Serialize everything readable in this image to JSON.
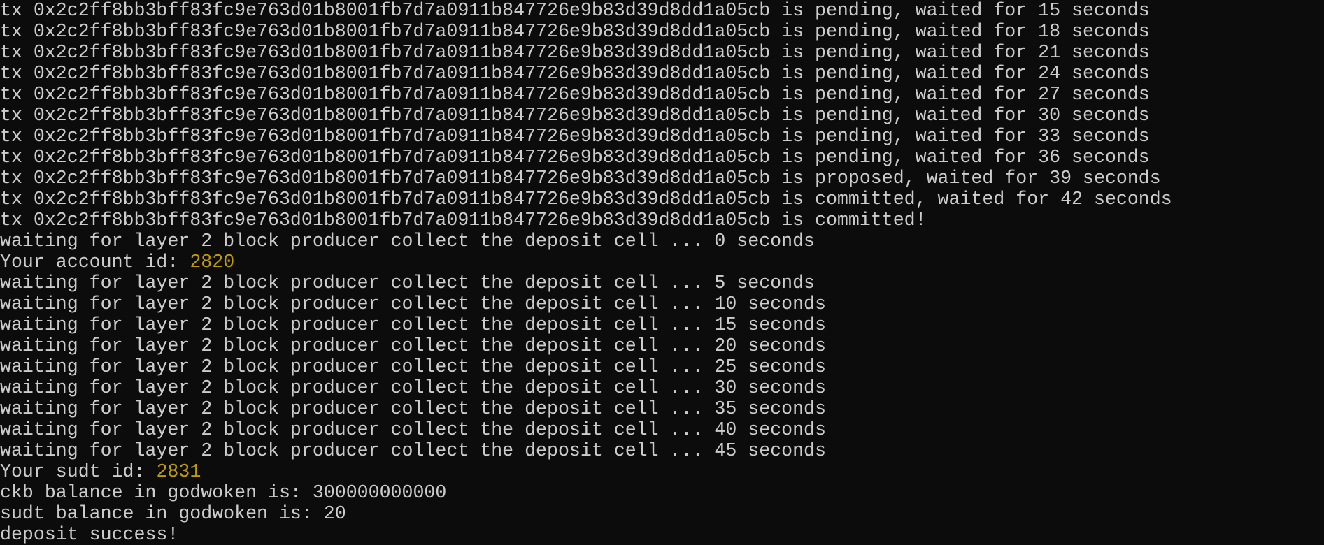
{
  "theme": {
    "background": "#0c0c0c",
    "foreground": "#cccccc",
    "highlight": "#c19c00"
  },
  "lines": [
    "tx 0x2c2ff8bb3bff83fc9e763d01b8001fb7d7a0911b847726e9b83d39d8dd1a05cb is pending, waited for 15 seconds",
    "tx 0x2c2ff8bb3bff83fc9e763d01b8001fb7d7a0911b847726e9b83d39d8dd1a05cb is pending, waited for 18 seconds",
    "tx 0x2c2ff8bb3bff83fc9e763d01b8001fb7d7a0911b847726e9b83d39d8dd1a05cb is pending, waited for 21 seconds",
    "tx 0x2c2ff8bb3bff83fc9e763d01b8001fb7d7a0911b847726e9b83d39d8dd1a05cb is pending, waited for 24 seconds",
    "tx 0x2c2ff8bb3bff83fc9e763d01b8001fb7d7a0911b847726e9b83d39d8dd1a05cb is pending, waited for 27 seconds",
    "tx 0x2c2ff8bb3bff83fc9e763d01b8001fb7d7a0911b847726e9b83d39d8dd1a05cb is pending, waited for 30 seconds",
    "tx 0x2c2ff8bb3bff83fc9e763d01b8001fb7d7a0911b847726e9b83d39d8dd1a05cb is pending, waited for 33 seconds",
    "tx 0x2c2ff8bb3bff83fc9e763d01b8001fb7d7a0911b847726e9b83d39d8dd1a05cb is pending, waited for 36 seconds",
    "tx 0x2c2ff8bb3bff83fc9e763d01b8001fb7d7a0911b847726e9b83d39d8dd1a05cb is proposed, waited for 39 seconds",
    "tx 0x2c2ff8bb3bff83fc9e763d01b8001fb7d7a0911b847726e9b83d39d8dd1a05cb is committed, waited for 42 seconds",
    "tx 0x2c2ff8bb3bff83fc9e763d01b8001fb7d7a0911b847726e9b83d39d8dd1a05cb is committed!",
    "waiting for layer 2 block producer collect the deposit cell ... 0 seconds"
  ],
  "account": {
    "label": "Your account id: ",
    "value": "2820"
  },
  "waiting_lines": [
    "waiting for layer 2 block producer collect the deposit cell ... 5 seconds",
    "waiting for layer 2 block producer collect the deposit cell ... 10 seconds",
    "waiting for layer 2 block producer collect the deposit cell ... 15 seconds",
    "waiting for layer 2 block producer collect the deposit cell ... 20 seconds",
    "waiting for layer 2 block producer collect the deposit cell ... 25 seconds",
    "waiting for layer 2 block producer collect the deposit cell ... 30 seconds",
    "waiting for layer 2 block producer collect the deposit cell ... 35 seconds",
    "waiting for layer 2 block producer collect the deposit cell ... 40 seconds",
    "waiting for layer 2 block producer collect the deposit cell ... 45 seconds"
  ],
  "sudt": {
    "label": "Your sudt id: ",
    "value": "2831"
  },
  "final_lines": [
    "ckb balance in godwoken is: 300000000000",
    "sudt balance in godwoken is: 20",
    "deposit success!"
  ]
}
